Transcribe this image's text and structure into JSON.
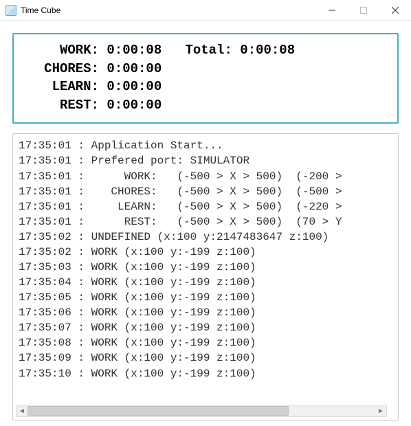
{
  "window": {
    "title": "Time Cube"
  },
  "summary": {
    "rows": [
      {
        "label": "WORK:",
        "value": "0:00:08",
        "extra_label": "Total:",
        "extra_value": "0:00:08"
      },
      {
        "label": "CHORES:",
        "value": "0:00:00"
      },
      {
        "label": "LEARN:",
        "value": "0:00:00"
      },
      {
        "label": "REST:",
        "value": "0:00:00"
      }
    ]
  },
  "log": {
    "lines": [
      "17:35:01 : Application Start...",
      "17:35:01 : Prefered port: SIMULATOR",
      "17:35:01 :      WORK:   (-500 > X > 500)  (-200 > ",
      "17:35:01 :    CHORES:   (-500 > X > 500)  (-500 > ",
      "17:35:01 :     LEARN:   (-500 > X > 500)  (-220 > ",
      "17:35:01 :      REST:   (-500 > X > 500)  (70 > Y ",
      "17:35:02 : UNDEFINED (x:100 y:2147483647 z:100)",
      "17:35:02 : WORK (x:100 y:-199 z:100)",
      "17:35:03 : WORK (x:100 y:-199 z:100)",
      "17:35:04 : WORK (x:100 y:-199 z:100)",
      "17:35:05 : WORK (x:100 y:-199 z:100)",
      "17:35:06 : WORK (x:100 y:-199 z:100)",
      "17:35:07 : WORK (x:100 y:-199 z:100)",
      "17:35:08 : WORK (x:100 y:-199 z:100)",
      "17:35:09 : WORK (x:100 y:-199 z:100)",
      "17:35:10 : WORK (x:100 y:-199 z:100)"
    ]
  }
}
